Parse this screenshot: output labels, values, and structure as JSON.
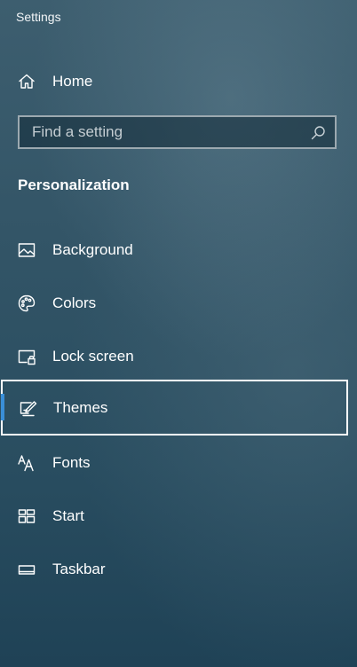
{
  "window": {
    "title": "Settings"
  },
  "home": {
    "label": "Home",
    "icon": "home-icon"
  },
  "search": {
    "placeholder": "Find a setting",
    "value": "",
    "icon": "search-icon"
  },
  "section": {
    "heading": "Personalization"
  },
  "nav": {
    "selected": "Themes",
    "accent_color": "#3a8fd8",
    "items": [
      {
        "label": "Background",
        "icon": "picture-icon"
      },
      {
        "label": "Colors",
        "icon": "palette-icon"
      },
      {
        "label": "Lock screen",
        "icon": "lock-screen-icon"
      },
      {
        "label": "Themes",
        "icon": "themes-icon"
      },
      {
        "label": "Fonts",
        "icon": "fonts-icon"
      },
      {
        "label": "Start",
        "icon": "start-icon"
      },
      {
        "label": "Taskbar",
        "icon": "taskbar-icon"
      }
    ]
  }
}
